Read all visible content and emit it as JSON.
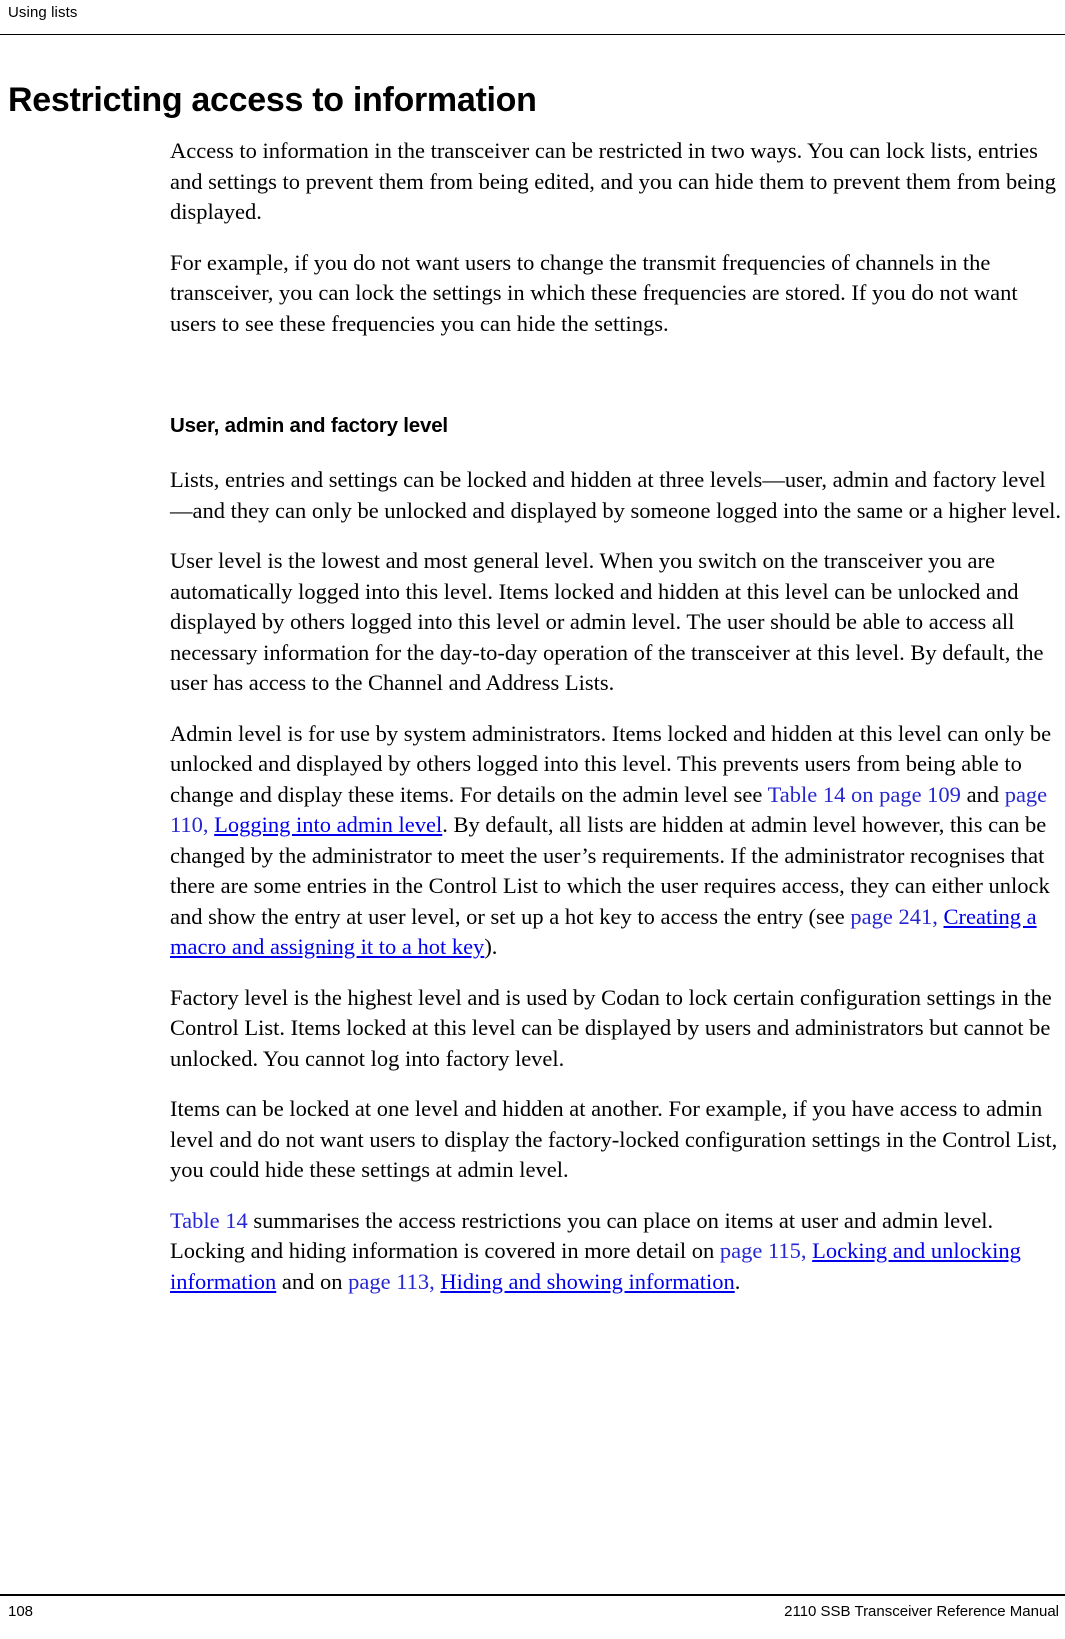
{
  "page": {
    "running_header": "Using lists",
    "title": "Restricting access to information",
    "footer_page_number": "108",
    "footer_manual_title": "2110 SSB Transceiver Reference Manual",
    "link_color": "#2727cf",
    "text_color": "#000000",
    "background_color": "#ffffff"
  },
  "body": {
    "paragraph_1": "Access to information in the transceiver can be restricted in two ways. You can lock lists, entries and settings to prevent them from being edited, and you can hide them to prevent them from being displayed.",
    "paragraph_2": "For example, if you do not want users to change the transmit frequencies of channels in the transceiver, you can lock the settings in which these frequencies are stored. If you do not want users to see these frequencies you can hide the settings.",
    "section_heading": "User, admin and factory level",
    "paragraph_3": "Lists, entries and settings can be locked and hidden at three levels—user, admin and factory level—and they can only be unlocked and displayed by someone logged into the same or a higher level.",
    "paragraph_4": "User level is the lowest and most general level. When you switch on the transceiver you are automatically logged into this level. Items locked and hidden at this level can be unlocked and displayed by others logged into this level or admin level. The user should be able to access all necessary information for the day-to-day operation of the transceiver at this level. By default, the user has access to the Channel and Address Lists.",
    "paragraph_5": {
      "segment_1": "Admin level is for use by system administrators. Items locked and hidden at this level can only be unlocked and displayed by others logged into this level. This prevents users from being able to change and display these items. For details on the admin level see ",
      "link_1": "Table 14 on page 109",
      "segment_2": " and ",
      "link_2a": "page 110, ",
      "link_2b": "Logging into admin level",
      "segment_3": ". By default, all lists are hidden at admin level however, this can be changed by the administrator to meet the user’s requirements. If the administrator recognises that there are some entries in the Control List to which the user requires access, they can either unlock and show the entry at user level, or set up a hot key to access the entry (see ",
      "link_3a": "page 241, ",
      "link_3b": "Creating a macro and assigning it to a hot key",
      "segment_4": ")."
    },
    "paragraph_6": "Factory level is the highest level and is used by Codan to lock certain configuration settings in the Control List. Items locked at this level can be displayed by users and administrators but cannot be unlocked. You cannot log into factory level.",
    "paragraph_7": "Items can be locked at one level and hidden at another. For example, if you have access to admin level and do not want users to display the factory-locked configuration settings in the Control List, you could hide these settings at admin level.",
    "paragraph_8": {
      "link_1": "Table 14",
      "segment_1": " summarises the access restrictions you can place on items at user and admin level. Locking and hiding information is covered in more detail on ",
      "link_2a": "page 115, ",
      "link_2b": "Locking and unlocking information",
      "segment_2": " and on ",
      "link_3a": "page 113, ",
      "link_3b": "Hiding and showing information",
      "segment_3": "."
    }
  }
}
